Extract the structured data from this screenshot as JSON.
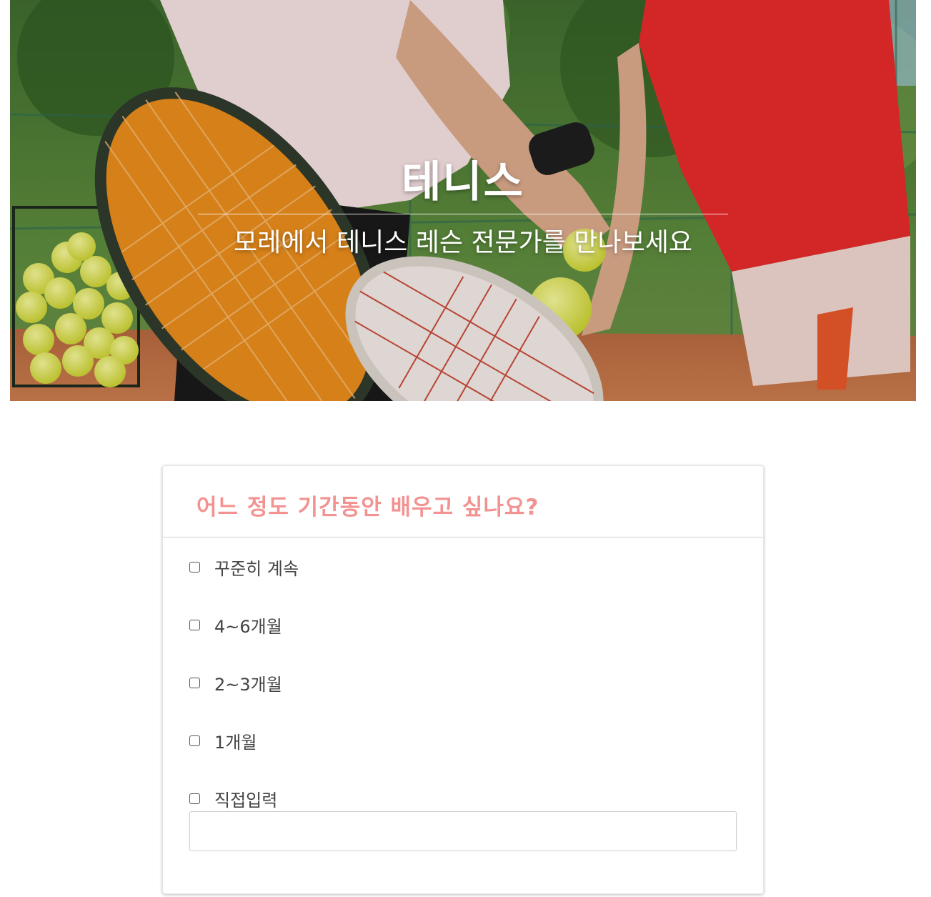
{
  "hero": {
    "title": "테니스",
    "subtitle": "모레에서 테니스 레슨 전문가를 만나보세요"
  },
  "question": {
    "title": "어느 정도 기간동안 배우고 싶나요?",
    "options": [
      {
        "label": "꾸준히 계속",
        "checked": false
      },
      {
        "label": "4~6개월",
        "checked": false
      },
      {
        "label": "2~3개월",
        "checked": false
      },
      {
        "label": "1개월",
        "checked": false
      },
      {
        "label": "직접입력",
        "checked": false
      }
    ],
    "custom_input": {
      "value": "",
      "placeholder": ""
    }
  },
  "colors": {
    "question_accent": "#f29391",
    "option_text": "#444444"
  }
}
